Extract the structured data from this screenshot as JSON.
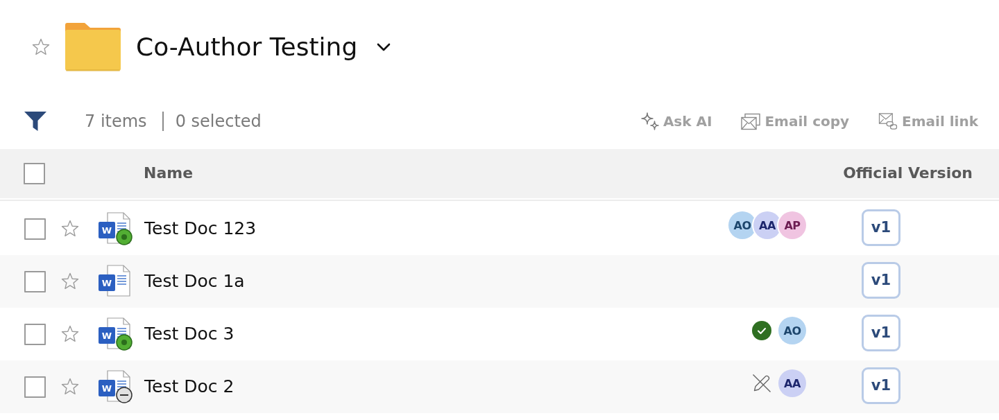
{
  "header": {
    "title": "Co-Author Testing",
    "favorite": false
  },
  "toolbar": {
    "count": "7 items",
    "selection": "0 selected",
    "actions": [
      {
        "kind": "ask-ai",
        "label": "Ask AI"
      },
      {
        "kind": "email-copy",
        "label": "Email copy"
      },
      {
        "kind": "email-link",
        "label": "Email link"
      }
    ]
  },
  "table": {
    "select_all": {
      "checked": false
    },
    "columns": [
      "Name",
      "Official Version"
    ],
    "rows": [
      {
        "name": "Test Doc 123",
        "file_type": "W",
        "checked": false,
        "favorite": false,
        "being_edited": true,
        "locked": false,
        "approved": false,
        "read_only": false,
        "collaborators": [
          {
            "initials": "AO",
            "color": "#b4d4f1"
          },
          {
            "initials": "AA",
            "color": "#cbd0f4"
          },
          {
            "initials": "AP",
            "color": "#f0c4e1"
          }
        ],
        "version": "v1"
      },
      {
        "name": "Test Doc 1a",
        "file_type": "W",
        "checked": false,
        "favorite": false,
        "being_edited": false,
        "locked": false,
        "approved": false,
        "read_only": false,
        "version": "v1"
      },
      {
        "name": "Test Doc 3",
        "file_type": "W",
        "checked": false,
        "favorite": false,
        "being_edited": true,
        "locked": false,
        "approved": true,
        "read_only": false,
        "collaborators": [
          {
            "initials": "AO",
            "color": "#b4d4f1"
          }
        ],
        "version": "v1"
      },
      {
        "name": "Test Doc 2",
        "file_type": "W",
        "checked": false,
        "favorite": false,
        "being_edited": false,
        "locked": true,
        "approved": false,
        "read_only": true,
        "collaborators": [
          {
            "initials": "AA",
            "color": "#cbd0f4"
          }
        ],
        "version": "v1"
      }
    ]
  }
}
